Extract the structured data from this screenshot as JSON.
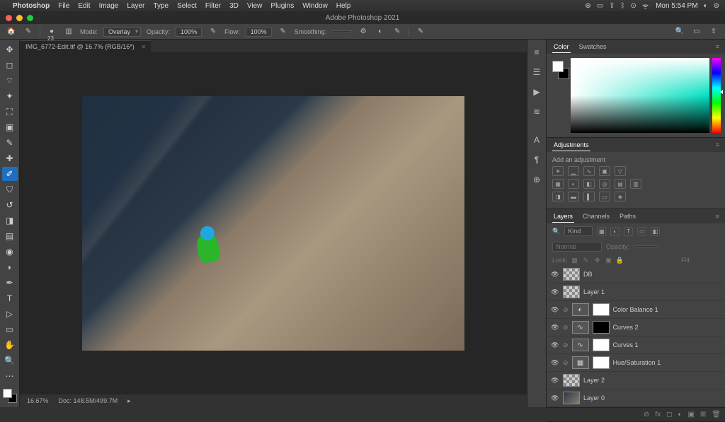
{
  "menubar": {
    "app": "Photoshop",
    "items": [
      "File",
      "Edit",
      "Image",
      "Layer",
      "Type",
      "Select",
      "Filter",
      "3D",
      "View",
      "Plugins",
      "Window",
      "Help"
    ],
    "clock": "Mon 5:54 PM"
  },
  "window": {
    "title": "Adobe Photoshop 2021"
  },
  "options": {
    "brush_size_label": "23",
    "mode_label": "Mode:",
    "mode_value": "Overlay",
    "opacity_label": "Opacity:",
    "opacity_value": "100%",
    "flow_label": "Flow:",
    "flow_value": "100%",
    "smoothing_label": "Smoothing:"
  },
  "document": {
    "tab": "IMG_6772-Edit.tif @ 16.7% (RGB/16*)"
  },
  "status": {
    "zoom": "16.67%",
    "docsize": "Doc: 148.5M/499.7M"
  },
  "panels": {
    "color_tab": "Color",
    "swatches_tab": "Swatches",
    "adjustments_tab": "Adjustments",
    "adjustments_hint": "Add an adjustment",
    "layers_tab": "Layers",
    "channels_tab": "Channels",
    "paths_tab": "Paths",
    "kind_label": "Kind",
    "blend_mode": "Normal",
    "blend_opacity_label": "Opacity:",
    "lock_label": "Lock:",
    "fill_label": "Fill:"
  },
  "layers": [
    {
      "name": "DB",
      "type": "pixel",
      "mask": false,
      "thumb": "checker"
    },
    {
      "name": "Layer 1",
      "type": "pixel",
      "mask": false,
      "thumb": "checker"
    },
    {
      "name": "Color Balance 1",
      "type": "adj",
      "mask": true,
      "icon": "◐"
    },
    {
      "name": "Curves 2",
      "type": "adj",
      "mask": true,
      "icon": "∿",
      "masktone": "dark"
    },
    {
      "name": "Curves 1",
      "type": "adj",
      "mask": true,
      "icon": "∿"
    },
    {
      "name": "Hue/Saturation 1",
      "type": "adj",
      "mask": true,
      "icon": "▦"
    },
    {
      "name": "Layer 2",
      "type": "pixel",
      "mask": false,
      "thumb": "checker"
    },
    {
      "name": "Layer 0",
      "type": "pixel",
      "mask": false,
      "thumb": "image"
    }
  ]
}
